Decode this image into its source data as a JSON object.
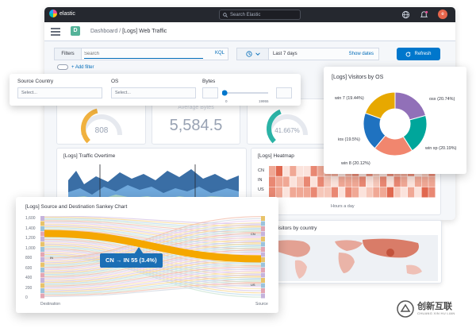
{
  "app": {
    "brand": "elastic",
    "search_placeholder": "Search Elastic",
    "user_initial": "e"
  },
  "breadcrumb": {
    "space_badge": "D",
    "root": "Dashboard",
    "separator": "/",
    "current": "[Logs] Web Traffic"
  },
  "query_bar": {
    "filters_label": "Filters",
    "search_placeholder": "Search",
    "language": "KQL",
    "date_range": "Last 7 days",
    "show_dates": "Show dates",
    "refresh_label": "Refresh",
    "add_filter": "+ Add filter"
  },
  "controls": {
    "source_country": {
      "label": "Source Country",
      "placeholder": "Select..."
    },
    "os": {
      "label": "OS",
      "placeholder": "Select..."
    },
    "bytes": {
      "label": "Bytes",
      "min": "0",
      "max": "19955",
      "value_fraction": 0.02
    }
  },
  "metrics": {
    "gauge_left": {
      "value": "808",
      "value_num": 808,
      "fill_fraction": 0.45
    },
    "average_bytes": {
      "label": "Average Bytes",
      "value": "5,584.5"
    },
    "gauge_right": {
      "value": "41.667%",
      "fill_fraction": 0.42
    }
  },
  "panels": {
    "traffic_overtime": {
      "title": "[Logs] Traffic Overtime"
    },
    "heatmap": {
      "title": "[Logs] Heatmap",
      "rows": [
        "CN",
        "IN",
        "US"
      ],
      "x_label": "Hours a day"
    },
    "unique_visitors": {
      "title": "Unique visitors by country"
    }
  },
  "visitors_by_os": {
    "title": "[Logs] Visitors by OS",
    "slices": [
      {
        "name": "osx",
        "label": "osx (20.74%)",
        "value": 20.74,
        "color": "#9170b8"
      },
      {
        "name": "win xp",
        "label": "win xp (20.19%)",
        "value": 20.19,
        "color": "#00a69b"
      },
      {
        "name": "win 8",
        "label": "win 8 (20.12%)",
        "value": 20.12,
        "color": "#f1866e"
      },
      {
        "name": "ios",
        "label": "ios (19.5%)",
        "value": 19.5,
        "color": "#1f72c0"
      },
      {
        "name": "win 7",
        "label": "win 7 (19.44%)",
        "value": 19.44,
        "color": "#e7a800"
      }
    ]
  },
  "sankey": {
    "title": "[Logs] Source and Destination Sankey Chart",
    "y_ticks": [
      "1,600",
      "1,400",
      "1,200",
      "1,000",
      "800",
      "600",
      "400",
      "200",
      "0"
    ],
    "y_values": [
      1600,
      1400,
      1200,
      1000,
      800,
      600,
      400,
      200,
      0
    ],
    "left_axis": "Destination",
    "right_axis": "Source",
    "node_label_in": "IN",
    "node_label_cn": "CN",
    "node_label_us": "US",
    "tooltip": "CN → IN 55 (3.4%)",
    "highlight_color": "#f5a700"
  },
  "watermark": {
    "text": "创新互联",
    "subtext": "CHUANG XIN HU LIAN"
  },
  "colors": {
    "topbar": "#25282f",
    "accent": "#0077cc",
    "link": "#006bb8"
  }
}
